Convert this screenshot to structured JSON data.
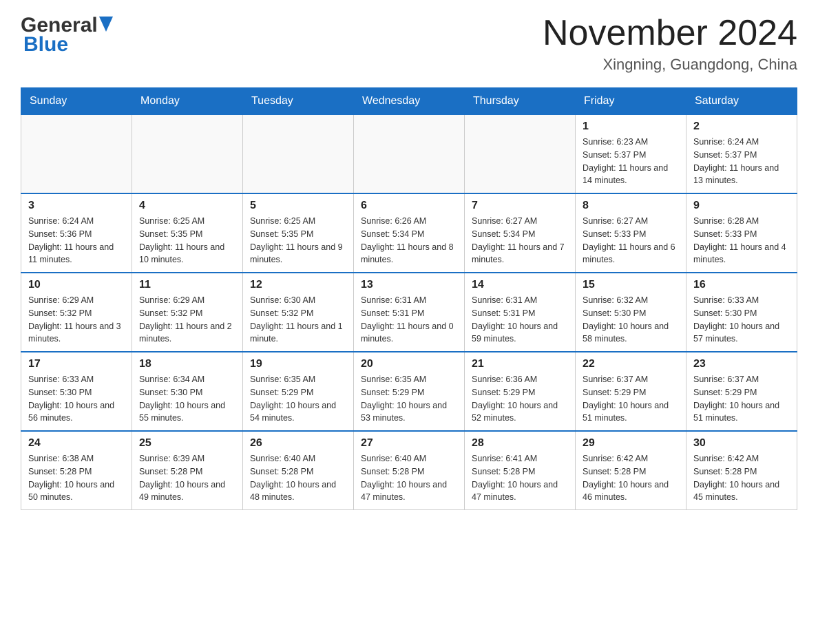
{
  "header": {
    "logo_general": "General",
    "logo_blue": "Blue",
    "month_title": "November 2024",
    "location": "Xingning, Guangdong, China"
  },
  "weekdays": [
    "Sunday",
    "Monday",
    "Tuesday",
    "Wednesday",
    "Thursday",
    "Friday",
    "Saturday"
  ],
  "weeks": [
    [
      {
        "day": "",
        "info": ""
      },
      {
        "day": "",
        "info": ""
      },
      {
        "day": "",
        "info": ""
      },
      {
        "day": "",
        "info": ""
      },
      {
        "day": "",
        "info": ""
      },
      {
        "day": "1",
        "info": "Sunrise: 6:23 AM\nSunset: 5:37 PM\nDaylight: 11 hours and 14 minutes."
      },
      {
        "day": "2",
        "info": "Sunrise: 6:24 AM\nSunset: 5:37 PM\nDaylight: 11 hours and 13 minutes."
      }
    ],
    [
      {
        "day": "3",
        "info": "Sunrise: 6:24 AM\nSunset: 5:36 PM\nDaylight: 11 hours and 11 minutes."
      },
      {
        "day": "4",
        "info": "Sunrise: 6:25 AM\nSunset: 5:35 PM\nDaylight: 11 hours and 10 minutes."
      },
      {
        "day": "5",
        "info": "Sunrise: 6:25 AM\nSunset: 5:35 PM\nDaylight: 11 hours and 9 minutes."
      },
      {
        "day": "6",
        "info": "Sunrise: 6:26 AM\nSunset: 5:34 PM\nDaylight: 11 hours and 8 minutes."
      },
      {
        "day": "7",
        "info": "Sunrise: 6:27 AM\nSunset: 5:34 PM\nDaylight: 11 hours and 7 minutes."
      },
      {
        "day": "8",
        "info": "Sunrise: 6:27 AM\nSunset: 5:33 PM\nDaylight: 11 hours and 6 minutes."
      },
      {
        "day": "9",
        "info": "Sunrise: 6:28 AM\nSunset: 5:33 PM\nDaylight: 11 hours and 4 minutes."
      }
    ],
    [
      {
        "day": "10",
        "info": "Sunrise: 6:29 AM\nSunset: 5:32 PM\nDaylight: 11 hours and 3 minutes."
      },
      {
        "day": "11",
        "info": "Sunrise: 6:29 AM\nSunset: 5:32 PM\nDaylight: 11 hours and 2 minutes."
      },
      {
        "day": "12",
        "info": "Sunrise: 6:30 AM\nSunset: 5:32 PM\nDaylight: 11 hours and 1 minute."
      },
      {
        "day": "13",
        "info": "Sunrise: 6:31 AM\nSunset: 5:31 PM\nDaylight: 11 hours and 0 minutes."
      },
      {
        "day": "14",
        "info": "Sunrise: 6:31 AM\nSunset: 5:31 PM\nDaylight: 10 hours and 59 minutes."
      },
      {
        "day": "15",
        "info": "Sunrise: 6:32 AM\nSunset: 5:30 PM\nDaylight: 10 hours and 58 minutes."
      },
      {
        "day": "16",
        "info": "Sunrise: 6:33 AM\nSunset: 5:30 PM\nDaylight: 10 hours and 57 minutes."
      }
    ],
    [
      {
        "day": "17",
        "info": "Sunrise: 6:33 AM\nSunset: 5:30 PM\nDaylight: 10 hours and 56 minutes."
      },
      {
        "day": "18",
        "info": "Sunrise: 6:34 AM\nSunset: 5:30 PM\nDaylight: 10 hours and 55 minutes."
      },
      {
        "day": "19",
        "info": "Sunrise: 6:35 AM\nSunset: 5:29 PM\nDaylight: 10 hours and 54 minutes."
      },
      {
        "day": "20",
        "info": "Sunrise: 6:35 AM\nSunset: 5:29 PM\nDaylight: 10 hours and 53 minutes."
      },
      {
        "day": "21",
        "info": "Sunrise: 6:36 AM\nSunset: 5:29 PM\nDaylight: 10 hours and 52 minutes."
      },
      {
        "day": "22",
        "info": "Sunrise: 6:37 AM\nSunset: 5:29 PM\nDaylight: 10 hours and 51 minutes."
      },
      {
        "day": "23",
        "info": "Sunrise: 6:37 AM\nSunset: 5:29 PM\nDaylight: 10 hours and 51 minutes."
      }
    ],
    [
      {
        "day": "24",
        "info": "Sunrise: 6:38 AM\nSunset: 5:28 PM\nDaylight: 10 hours and 50 minutes."
      },
      {
        "day": "25",
        "info": "Sunrise: 6:39 AM\nSunset: 5:28 PM\nDaylight: 10 hours and 49 minutes."
      },
      {
        "day": "26",
        "info": "Sunrise: 6:40 AM\nSunset: 5:28 PM\nDaylight: 10 hours and 48 minutes."
      },
      {
        "day": "27",
        "info": "Sunrise: 6:40 AM\nSunset: 5:28 PM\nDaylight: 10 hours and 47 minutes."
      },
      {
        "day": "28",
        "info": "Sunrise: 6:41 AM\nSunset: 5:28 PM\nDaylight: 10 hours and 47 minutes."
      },
      {
        "day": "29",
        "info": "Sunrise: 6:42 AM\nSunset: 5:28 PM\nDaylight: 10 hours and 46 minutes."
      },
      {
        "day": "30",
        "info": "Sunrise: 6:42 AM\nSunset: 5:28 PM\nDaylight: 10 hours and 45 minutes."
      }
    ]
  ]
}
